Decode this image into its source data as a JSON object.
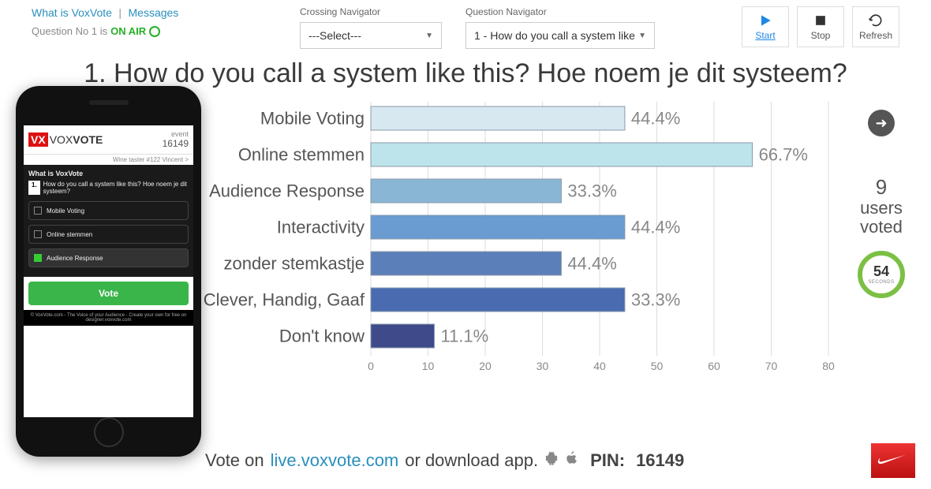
{
  "nav": {
    "link1": "What is VoxVote",
    "link2": "Messages",
    "status_prefix": "Question No 1 is",
    "status_value": "ON AIR",
    "crossing_label": "Crossing Navigator",
    "crossing_value": "---Select---",
    "question_label": "Question Navigator",
    "question_value": "1 - How do you call a system like"
  },
  "actions": {
    "start": "Start",
    "stop": "Stop",
    "refresh": "Refresh"
  },
  "title": "1. How do you call a system like this? Hoe noem je dit systeem?",
  "right": {
    "users_count": "9",
    "users_label": "users\nvoted",
    "seconds": "54",
    "seconds_label": "SECONDS"
  },
  "footer": {
    "vote_on": "Vote on",
    "url": "live.voxvote.com",
    "or_download": "or download app.",
    "pin_label": "PIN:",
    "pin_value": "16149"
  },
  "phone": {
    "brand_prefix": "VX",
    "brand_main": "VOX",
    "brand_suffix": "VOTE",
    "event_label": "event",
    "event_id": "16149",
    "subline": "Wine taster #122 Vincent  >",
    "section_title": "What is VoxVote",
    "question_num": "1.",
    "question_text": "How do you call a system like this? Hoe noem je dit systeem?",
    "opts": [
      "Mobile Voting",
      "Online stemmen",
      "Audience Response"
    ],
    "vote_btn": "Vote",
    "foot": "© VoxVote.com - The Voice of your Audience - Create your own for free on designer.voxvote.com"
  },
  "chart_data": {
    "type": "bar",
    "orientation": "horizontal",
    "categories": [
      "Mobile Voting",
      "Online stemmen",
      "Audience Response",
      "Interactivity",
      "zonder stemkastje",
      "Clever, Handig, Gaaf",
      "Don't know"
    ],
    "values": [
      44.4,
      66.7,
      33.3,
      44.4,
      33.3,
      44.4,
      11.1
    ],
    "value_labels": [
      "44.4%",
      "66.7%",
      "33.3%",
      "44.4%",
      "44.4%",
      "33.3%",
      "11.1%"
    ],
    "colors": [
      "#d8e8f0",
      "#bde4ea",
      "#8ab6d6",
      "#6a9bd1",
      "#5b7fb8",
      "#4a6bb0",
      "#3f4a8a"
    ],
    "xticks": [
      0,
      10,
      20,
      30,
      40,
      50,
      60,
      70,
      80
    ],
    "xlim": [
      0,
      80
    ]
  }
}
